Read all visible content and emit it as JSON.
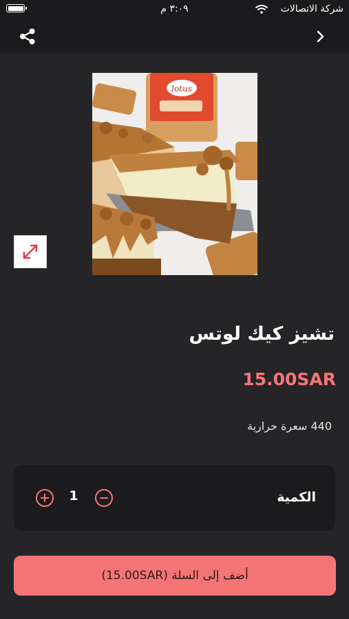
{
  "status_bar": {
    "carrier": "شركة الاتصالات",
    "time": "٣:٠٩ م",
    "wifi_icon": "wifi-icon",
    "battery_icon": "battery-icon"
  },
  "nav": {
    "back_icon": "chevron-right-icon",
    "share_icon": "share-icon"
  },
  "product": {
    "image_alt": "lotus-cheesecake-photo",
    "expand_icon": "expand-icon",
    "title": "تشيز كيك لوتس",
    "price": "15.00SAR",
    "calories": "440 سعرة حرارية"
  },
  "quantity": {
    "label": "الكمية",
    "value": "1",
    "plus_icon": "plus-circle-icon",
    "minus_icon": "minus-circle-icon"
  },
  "cart": {
    "button_label": "أضف إلى السلة (15.00SAR)"
  },
  "colors": {
    "background": "#252528",
    "bar": "#1b1b1d",
    "accent": "#f57577",
    "text": "#ffffff"
  }
}
